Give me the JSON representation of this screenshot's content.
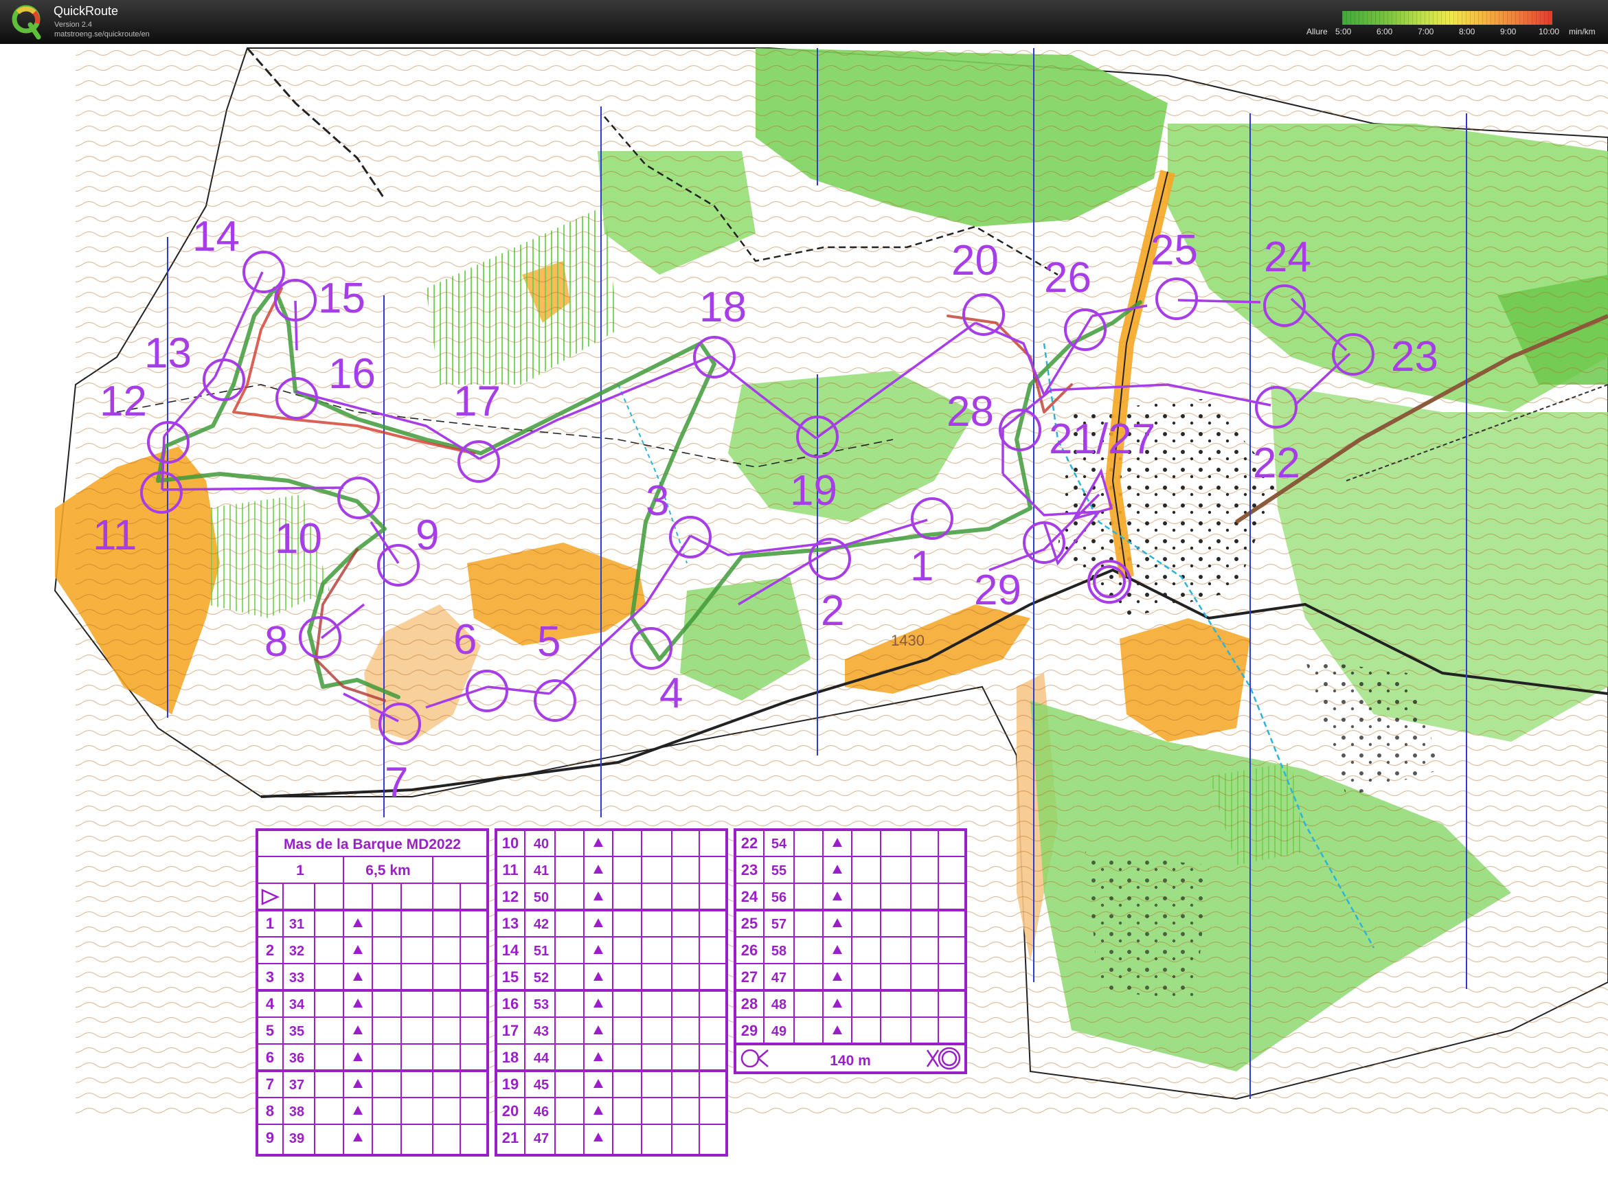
{
  "app": {
    "name": "QuickRoute",
    "version": "Version 2.4",
    "url": "matstroeng.se/quickroute/en"
  },
  "pace_legend": {
    "label": "Allure",
    "ticks": [
      "5:00",
      "6:00",
      "7:00",
      "8:00",
      "9:00",
      "10:00"
    ],
    "unit": "min/km"
  },
  "colors": {
    "course": "#a63de6",
    "description_purple": "#9a1fc8",
    "forest_green": "#7dd35e",
    "open_yellow": "#f5a623",
    "contour_brown": "#b5651d",
    "north_lines": "#2b3bd4"
  },
  "map": {
    "elevation_label": "1430",
    "controls": [
      "11",
      "12",
      "13",
      "14",
      "15",
      "16",
      "17",
      "18",
      "19",
      "20",
      "21/27",
      "22",
      "23",
      "24",
      "25",
      "26",
      "28",
      "29",
      "1",
      "2",
      "3",
      "4",
      "5",
      "6",
      "7",
      "8",
      "9",
      "10"
    ]
  },
  "control_description": {
    "title": "Mas de la Barque MD2022",
    "class": "1",
    "length": "6,5 km",
    "finish_distance": "140 m",
    "col1": [
      {
        "n": "1",
        "code": "31"
      },
      {
        "n": "2",
        "code": "32"
      },
      {
        "n": "3",
        "code": "33"
      },
      {
        "n": "4",
        "code": "34"
      },
      {
        "n": "5",
        "code": "35"
      },
      {
        "n": "6",
        "code": "36"
      },
      {
        "n": "7",
        "code": "37"
      },
      {
        "n": "8",
        "code": "38"
      },
      {
        "n": "9",
        "code": "39"
      }
    ],
    "col2": [
      {
        "n": "10",
        "code": "40"
      },
      {
        "n": "11",
        "code": "41"
      },
      {
        "n": "12",
        "code": "50"
      },
      {
        "n": "13",
        "code": "42"
      },
      {
        "n": "14",
        "code": "51"
      },
      {
        "n": "15",
        "code": "52"
      },
      {
        "n": "16",
        "code": "53"
      },
      {
        "n": "17",
        "code": "43"
      },
      {
        "n": "18",
        "code": "44"
      },
      {
        "n": "19",
        "code": "45"
      },
      {
        "n": "20",
        "code": "46"
      },
      {
        "n": "21",
        "code": "47"
      }
    ],
    "col3": [
      {
        "n": "22",
        "code": "54"
      },
      {
        "n": "23",
        "code": "55"
      },
      {
        "n": "24",
        "code": "56"
      },
      {
        "n": "25",
        "code": "57"
      },
      {
        "n": "26",
        "code": "58"
      },
      {
        "n": "27",
        "code": "47"
      },
      {
        "n": "28",
        "code": "48"
      },
      {
        "n": "29",
        "code": "49"
      }
    ]
  }
}
